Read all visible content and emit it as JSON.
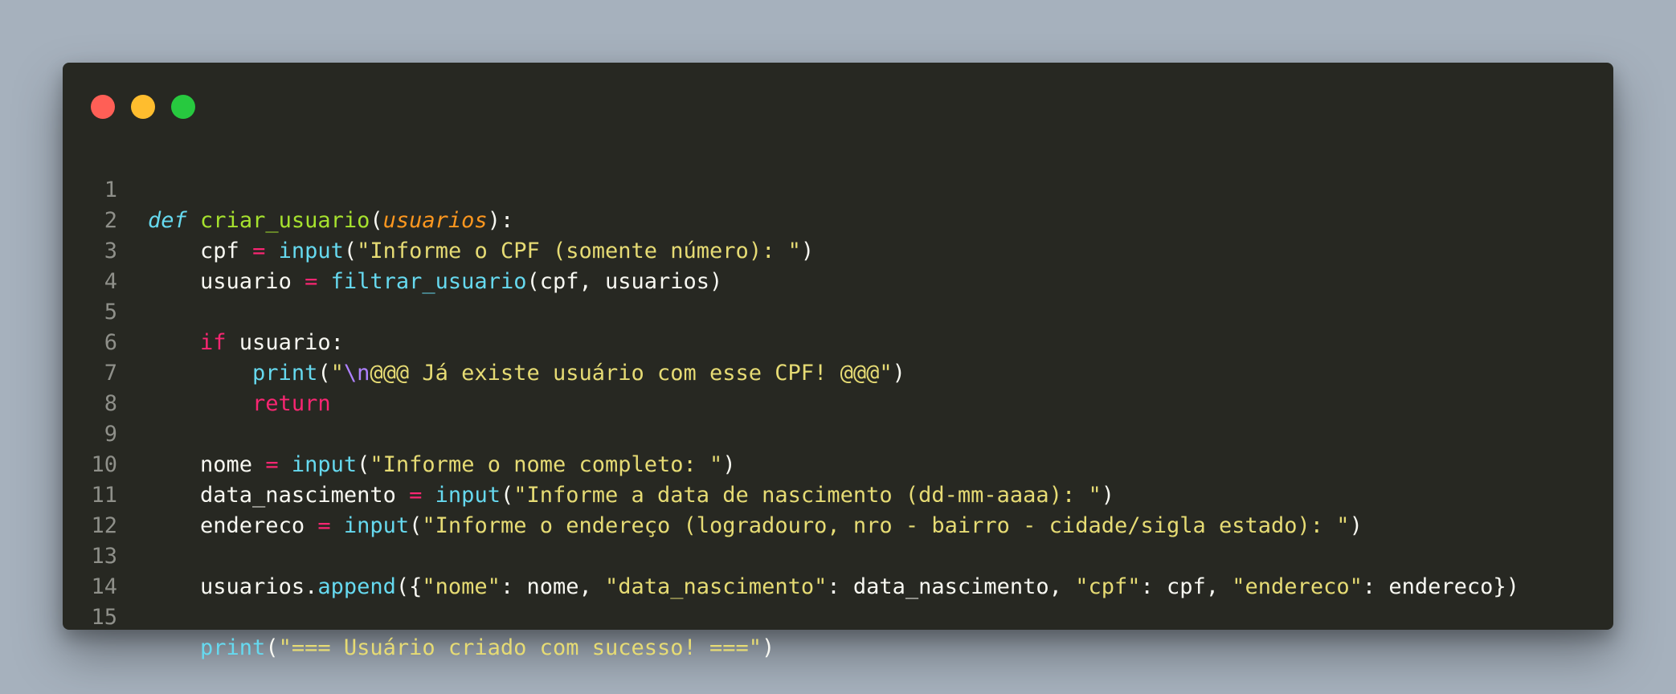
{
  "window": {
    "traffic_lights": {
      "close_color": "#ff5f56",
      "minimize_color": "#ffbd2e",
      "maximize_color": "#27c93f"
    }
  },
  "theme": {
    "background": "#272822",
    "keyword": "#f92672",
    "function": "#a6e22e",
    "builtin": "#66d9ef",
    "string": "#e6db74",
    "parameter": "#fd971f",
    "escape": "#ae81ff",
    "line_number": "#8f908a"
  },
  "code": {
    "line_numbers": [
      "1",
      "2",
      "3",
      "4",
      "5",
      "6",
      "7",
      "8",
      "9",
      "10",
      "11",
      "12",
      "13",
      "14",
      "15"
    ],
    "l1": {
      "def": "def",
      "name": "criar_usuario",
      "open": "(",
      "param": "usuarios",
      "close": "):"
    },
    "l2": {
      "indent": "    ",
      "var": "cpf",
      "sp1": " ",
      "eq": "=",
      "sp2": " ",
      "call": "input",
      "open": "(",
      "str": "\"Informe o CPF (somente número): \"",
      "close": ")"
    },
    "l3": {
      "indent": "    ",
      "var": "usuario",
      "sp1": " ",
      "eq": "=",
      "sp2": " ",
      "call": "filtrar_usuario",
      "args": "(cpf, usuarios)"
    },
    "l5": {
      "indent": "    ",
      "kw": "if",
      "rest": " usuario:"
    },
    "l6": {
      "indent": "        ",
      "call": "print",
      "open": "(",
      "q1": "\"",
      "esc": "\\n",
      "str": "@@@ Já existe usuário com esse CPF! @@@\"",
      "close": ")"
    },
    "l7": {
      "indent": "        ",
      "kw": "return"
    },
    "l9": {
      "indent": "    ",
      "var": "nome",
      "sp1": " ",
      "eq": "=",
      "sp2": " ",
      "call": "input",
      "open": "(",
      "str": "\"Informe o nome completo: \"",
      "close": ")"
    },
    "l10": {
      "indent": "    ",
      "var": "data_nascimento",
      "sp1": " ",
      "eq": "=",
      "sp2": " ",
      "call": "input",
      "open": "(",
      "str": "\"Informe a data de nascimento (dd-mm-aaaa): \"",
      "close": ")"
    },
    "l11": {
      "indent": "    ",
      "var": "endereco",
      "sp1": " ",
      "eq": "=",
      "sp2": " ",
      "call": "input",
      "open": "(",
      "str": "\"Informe o endereço (logradouro, nro - bairro - cidade/sigla estado): \"",
      "close": ")"
    },
    "l13": {
      "indent": "    ",
      "obj": "usuarios.",
      "call": "append",
      "open": "({",
      "k1": "\"nome\"",
      "v1": ": nome, ",
      "k2": "\"data_nascimento\"",
      "v2": ": data_nascimento, ",
      "k3": "\"cpf\"",
      "v3": ": cpf, ",
      "k4": "\"endereco\"",
      "v4": ": endereco})"
    },
    "l15": {
      "indent": "    ",
      "call": "print",
      "open": "(",
      "str": "\"=== Usuário criado com sucesso! ===\"",
      "close": ")"
    }
  }
}
